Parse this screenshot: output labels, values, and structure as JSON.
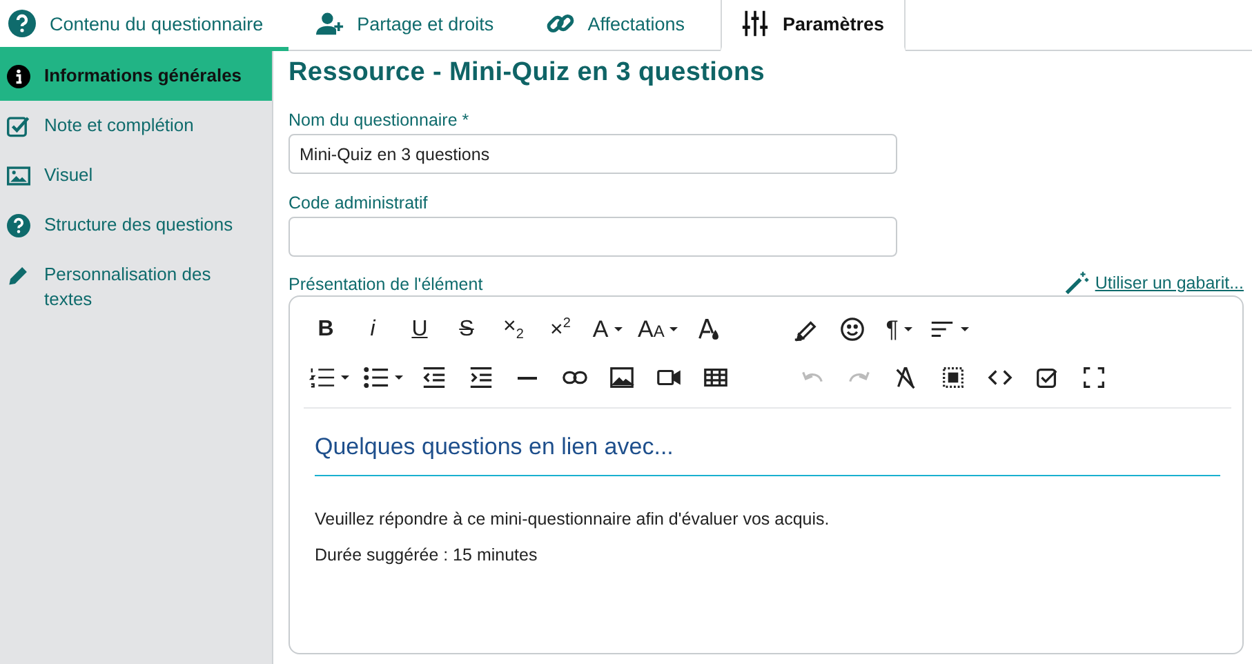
{
  "tabs": [
    {
      "label": "Contenu du questionnaire",
      "selected": false,
      "underlined": true
    },
    {
      "label": "Partage et droits",
      "selected": false,
      "underlined": false
    },
    {
      "label": "Affectations",
      "selected": false,
      "underlined": false
    },
    {
      "label": "Paramètres",
      "selected": true,
      "underlined": false
    }
  ],
  "sidebar": {
    "items": [
      {
        "label": "Informations générales",
        "selected": true
      },
      {
        "label": "Note et complétion",
        "selected": false
      },
      {
        "label": "Visuel",
        "selected": false
      },
      {
        "label": "Structure des questions",
        "selected": false
      },
      {
        "label": "Personnalisation des textes",
        "selected": false
      }
    ]
  },
  "title": "Ressource - Mini-Quiz en 3 questions",
  "fields": [
    {
      "label": "Nom du questionnaire *",
      "value": "Mini-Quiz en 3 questions"
    },
    {
      "label": "Code administratif"
    }
  ],
  "editor": {
    "label": "Présentation de l'élément",
    "template_link": "Utiliser un gabarit...",
    "toolbar_rows": [
      [
        {
          "kind": "bold",
          "label": "B"
        },
        {
          "kind": "italic",
          "label": "i"
        },
        {
          "kind": "underline",
          "label": "U"
        },
        {
          "kind": "strike",
          "label": "S"
        },
        {
          "kind": "sub",
          "label": "×",
          "sub": "2"
        },
        {
          "kind": "sup",
          "label": "×",
          "sup": "2"
        },
        {
          "kind": "font",
          "label": "A",
          "dropdown": true
        },
        {
          "kind": "size",
          "label": "A",
          "small": "A",
          "dropdown": true
        },
        {
          "kind": "textcolor"
        },
        {
          "kind": "gap"
        },
        {
          "kind": "highlight"
        },
        {
          "kind": "emoji"
        },
        {
          "kind": "paragraph",
          "label": "¶",
          "dropdown": true
        },
        {
          "kind": "align",
          "dropdown": true
        }
      ],
      [
        {
          "kind": "ol",
          "dropdown": true
        },
        {
          "kind": "ul",
          "dropdown": true
        },
        {
          "kind": "outdent"
        },
        {
          "kind": "indent"
        },
        {
          "kind": "hr"
        },
        {
          "kind": "link"
        },
        {
          "kind": "image"
        },
        {
          "kind": "video"
        },
        {
          "kind": "table"
        },
        {
          "kind": "gap"
        },
        {
          "kind": "undo",
          "disabled": true
        },
        {
          "kind": "redo",
          "disabled": true
        },
        {
          "kind": "clear"
        },
        {
          "kind": "selectall"
        },
        {
          "kind": "code"
        },
        {
          "kind": "checkbox"
        },
        {
          "kind": "fullscreen"
        }
      ]
    ],
    "content": [
      {
        "kind": "heading",
        "text": "Quelques questions en lien avec..."
      },
      {
        "kind": "paragraph",
        "text": "Veuillez répondre à ce mini-questionnaire afin d'évaluer vos acquis."
      },
      {
        "kind": "paragraph",
        "text": "Durée suggérée : 15 minutes"
      }
    ]
  }
}
